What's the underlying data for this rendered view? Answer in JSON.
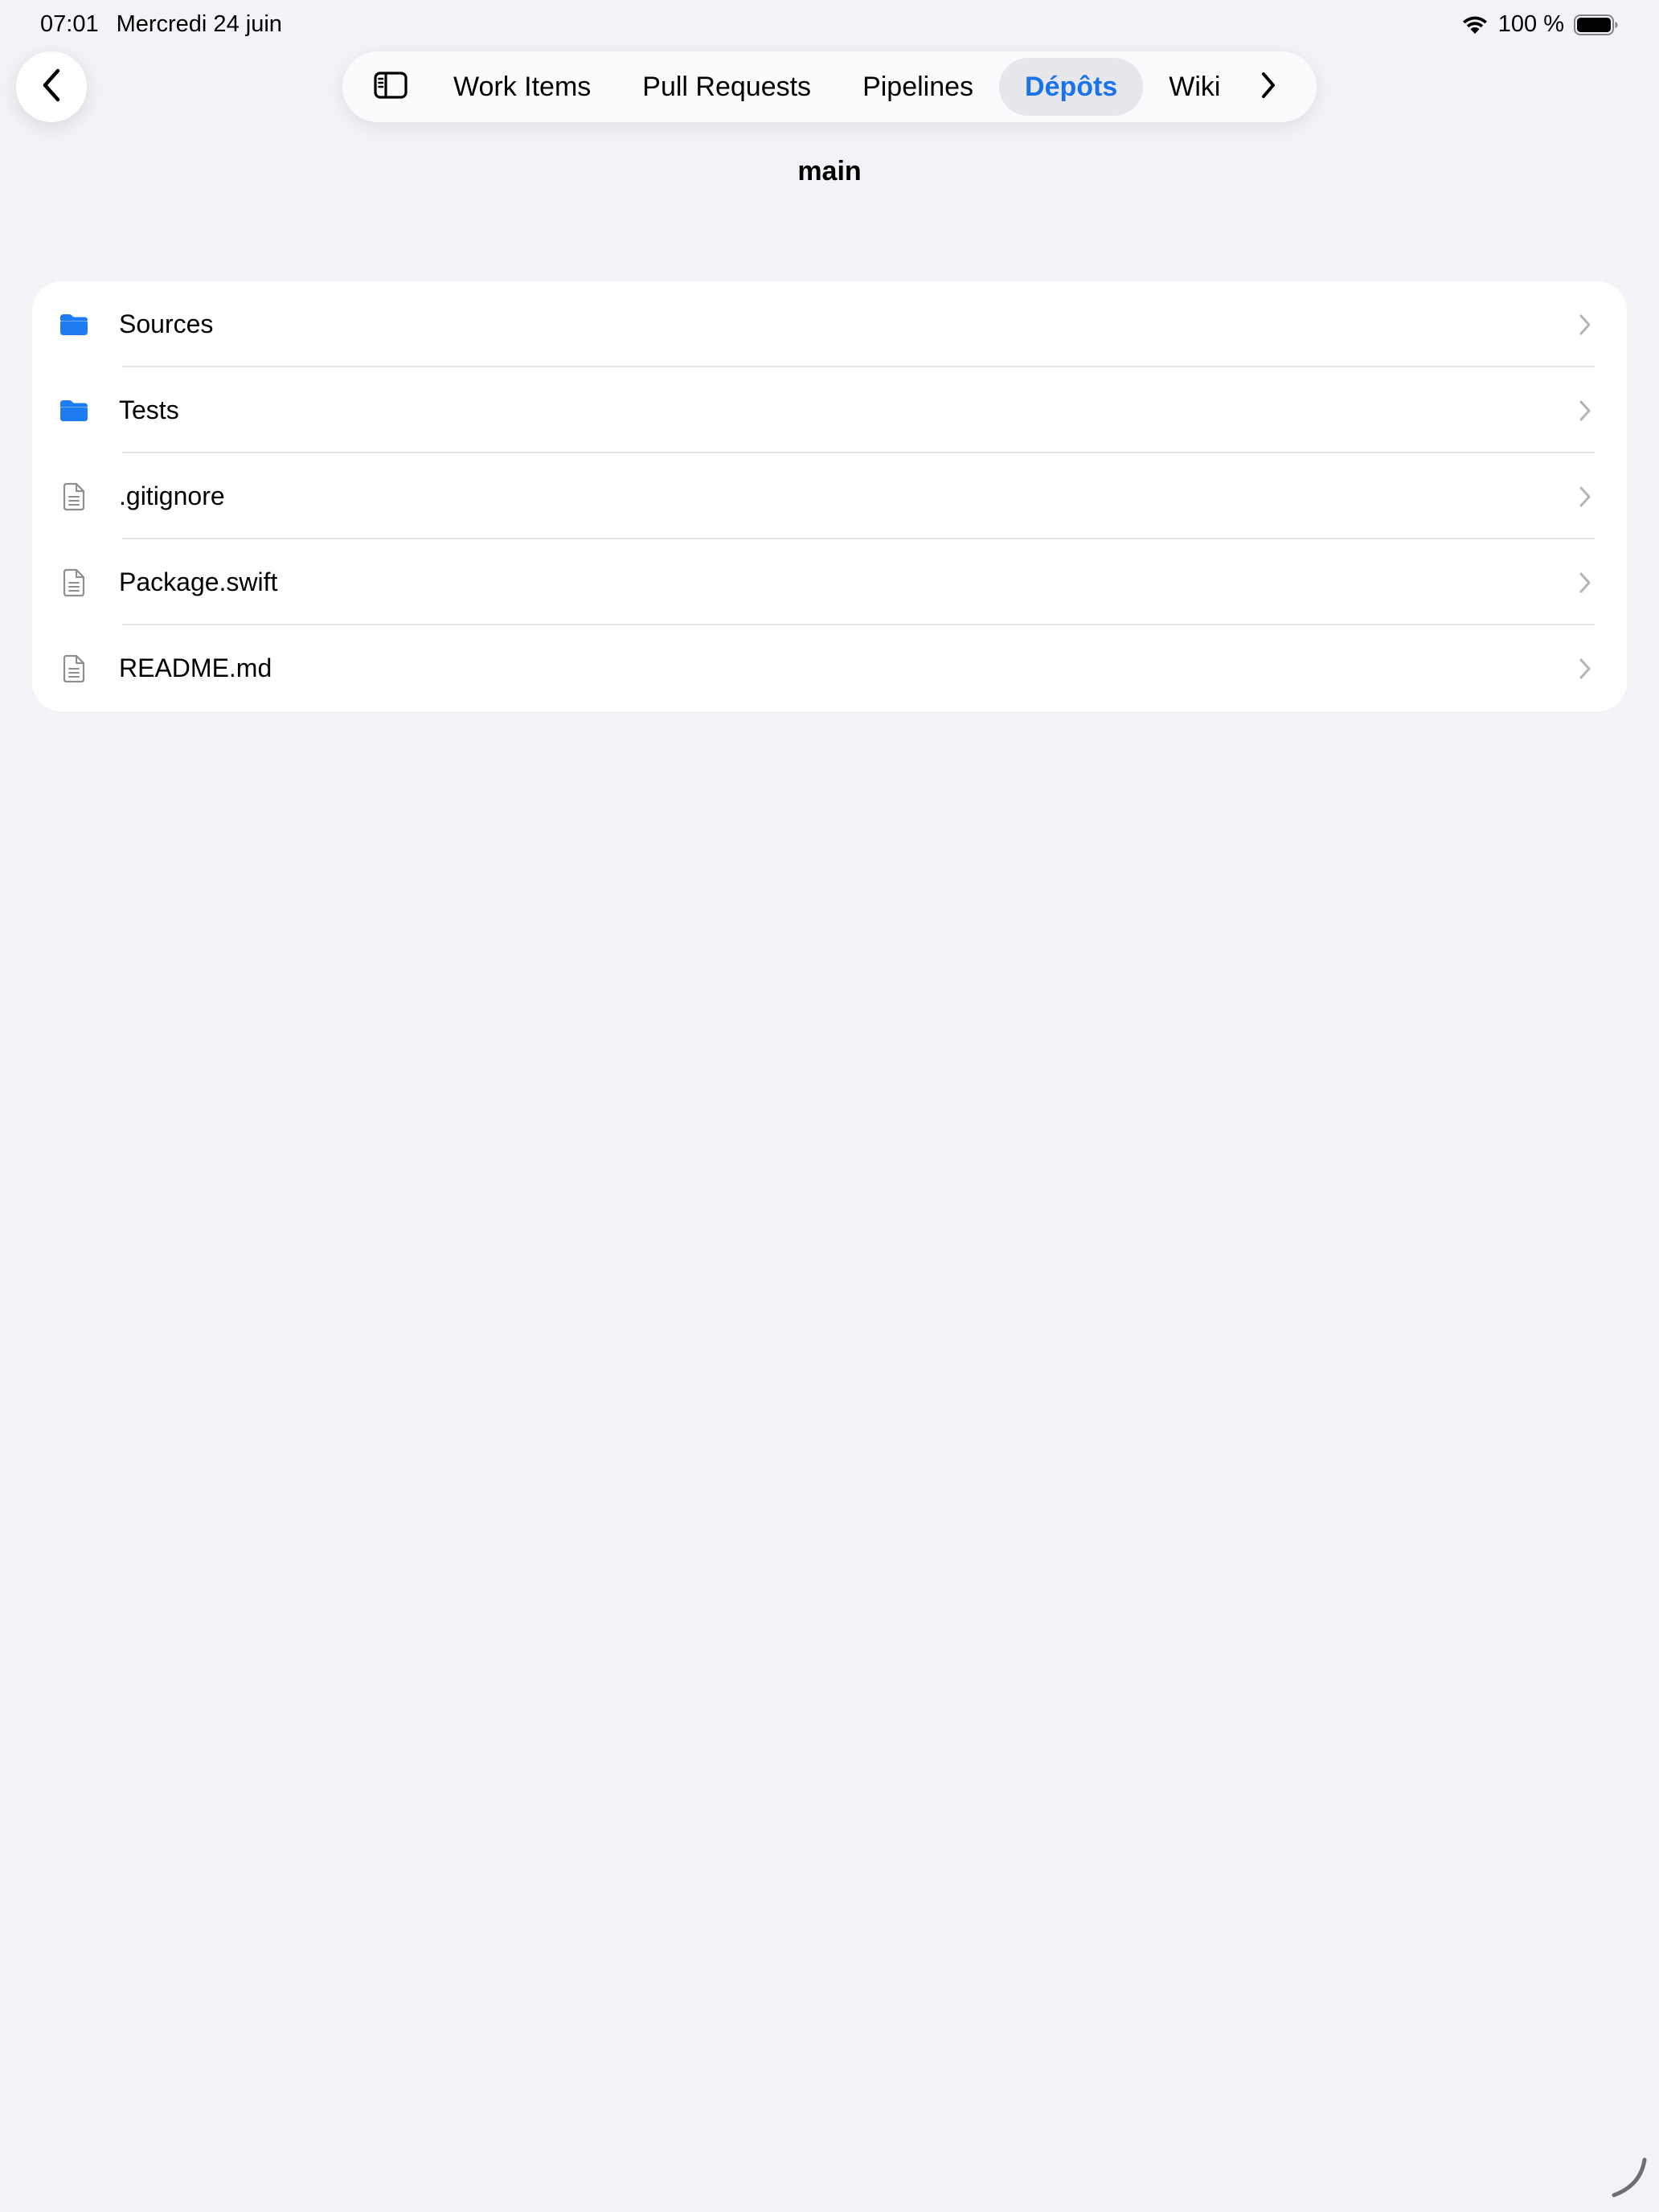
{
  "status_bar": {
    "time": "07:01",
    "date": "Mercredi 24 juin",
    "battery": "100 %"
  },
  "nav": {
    "tabs": [
      {
        "label": "Work Items",
        "active": false
      },
      {
        "label": "Pull Requests",
        "active": false
      },
      {
        "label": "Pipelines",
        "active": false
      },
      {
        "label": "Dépôts",
        "active": true
      },
      {
        "label": "Wiki",
        "active": false
      }
    ]
  },
  "page": {
    "title": "main"
  },
  "files": [
    {
      "name": "Sources",
      "type": "folder",
      "icon": "folder-icon"
    },
    {
      "name": "Tests",
      "type": "folder",
      "icon": "folder-icon"
    },
    {
      "name": ".gitignore",
      "type": "file",
      "icon": "document-icon"
    },
    {
      "name": "Package.swift",
      "type": "file",
      "icon": "document-icon"
    },
    {
      "name": "README.md",
      "type": "file",
      "icon": "document-icon"
    }
  ],
  "colors": {
    "accent": "#1a73e8",
    "folder": "#1e7cf2",
    "background": "#f2f2f7"
  }
}
